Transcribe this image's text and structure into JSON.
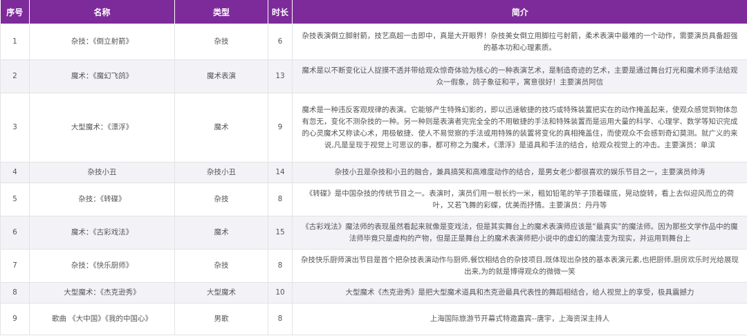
{
  "headers": {
    "index": "序号",
    "name": "名称",
    "type": "类型",
    "duration": "时长",
    "description": "简介"
  },
  "rows": [
    {
      "index": "1",
      "name": "杂技：《倒立射箭》",
      "type": "杂技",
      "duration": "6",
      "description": "杂技表演倒立脚射箭，技艺高超一击即中，真是大开眼界！杂技美女倒立用脚拉弓射箭，柔术表演中最难的一个动作，需要演员具备超强的基本功和心理素质。"
    },
    {
      "index": "2",
      "name": "魔术：《魔幻飞鸽》",
      "type": "魔术表演",
      "duration": "13",
      "description": "魔术是以不断变化让人捉摸不透并带给观众惊奇体验为核心的一种表演艺术，是制造奇迹的艺术，主要是通过舞台灯光和魔术师手法给观众一假象，鸽子象征和平，寓意很好！主要演员阿信"
    },
    {
      "index": "3",
      "name": "大型魔术：《漂浮》",
      "type": "魔术",
      "duration": "9",
      "description": "魔术是一种违反客观规律的表演。它能够产生特殊幻影的，即以迅速敏捷的技巧或特殊装置把实在的动作掩盖起来，使观众感觉到物体忽有忽无，变化不测杂技的一种。另一种则是表演者完完全全的不用敏捷的手法和特殊装置而是运用大量的科学、心理学、数学等知识完成的心灵魔术又称读心术，用极敏捷、使人不易觉察的手法或用特殊的装置将变化的真相掩盖住，而使观众不会感到奇幻莫测。就广义的来说,凡是呈现于视觉上可思议的事，都可称之为魔术，《漂浮》是道具和手法的结合，给观众视觉上的冲击。主要演员：单滨"
    },
    {
      "index": "4",
      "name": "杂技小丑",
      "type": "杂技小丑",
      "duration": "14",
      "description": "杂技小丑是杂技和小丑的融合，兼具搞笑和高难度动作的结合，是男女老少都很喜欢的娱乐节目之一，主要演员帅涛"
    },
    {
      "index": "5",
      "name": "杂技：《转碟》",
      "type": "杂技",
      "duration": "8",
      "description": "《转碟》是中国杂技的传统节目之一。表演时，演员们用一根长约一米，粗如铅笔的竿子顶着碟底，晃动旋转，看上去似迎风而立的荷叶，又若飞舞的彩蝶，优美而抒情。主要演员：丹丹等"
    },
    {
      "index": "6",
      "name": "魔术：《古彩戏法》",
      "type": "魔术",
      "duration": "15",
      "description": "《古彩戏法》魔法师的表现虽然看起来就像是变戏法，但是其实舞台上的魔术表演师应该是“最真实”的魔法师。因为那些文学作品中的魔法师毕竟只是虚构的产物，但是正是舞台上的魔术表演师把小说中的虚幻的魔法变为现实，并运用到舞台上"
    },
    {
      "index": "7",
      "name": "杂技：《快乐厨师》",
      "type": "杂技",
      "duration": "8",
      "description": "杂技快乐厨师演出节目是首个把杂技表演动作与厨师,餐饮相结合的杂技项目,既体现出杂技的基本表演元素,也把厨师,厨房欢乐时光给展现出来,为的就是博得观众的微微一笑"
    },
    {
      "index": "8",
      "name": "大型魔术：《杰克逊秀》",
      "type": "大型魔术",
      "duration": "10",
      "description": "大型魔术《杰克逊秀》是把大型魔术道具和杰克逊最具代表性的舞蹈相结合，给人视觉上的享受，极具震撼力"
    },
    {
      "index": "9",
      "name": "歌曲 《大中国》《我的中国心》",
      "type": "男歌",
      "duration": "8",
      "description": "上海国际旅游节开幕式特邀嘉宾--唐宇，上海资深主持人"
    }
  ]
}
